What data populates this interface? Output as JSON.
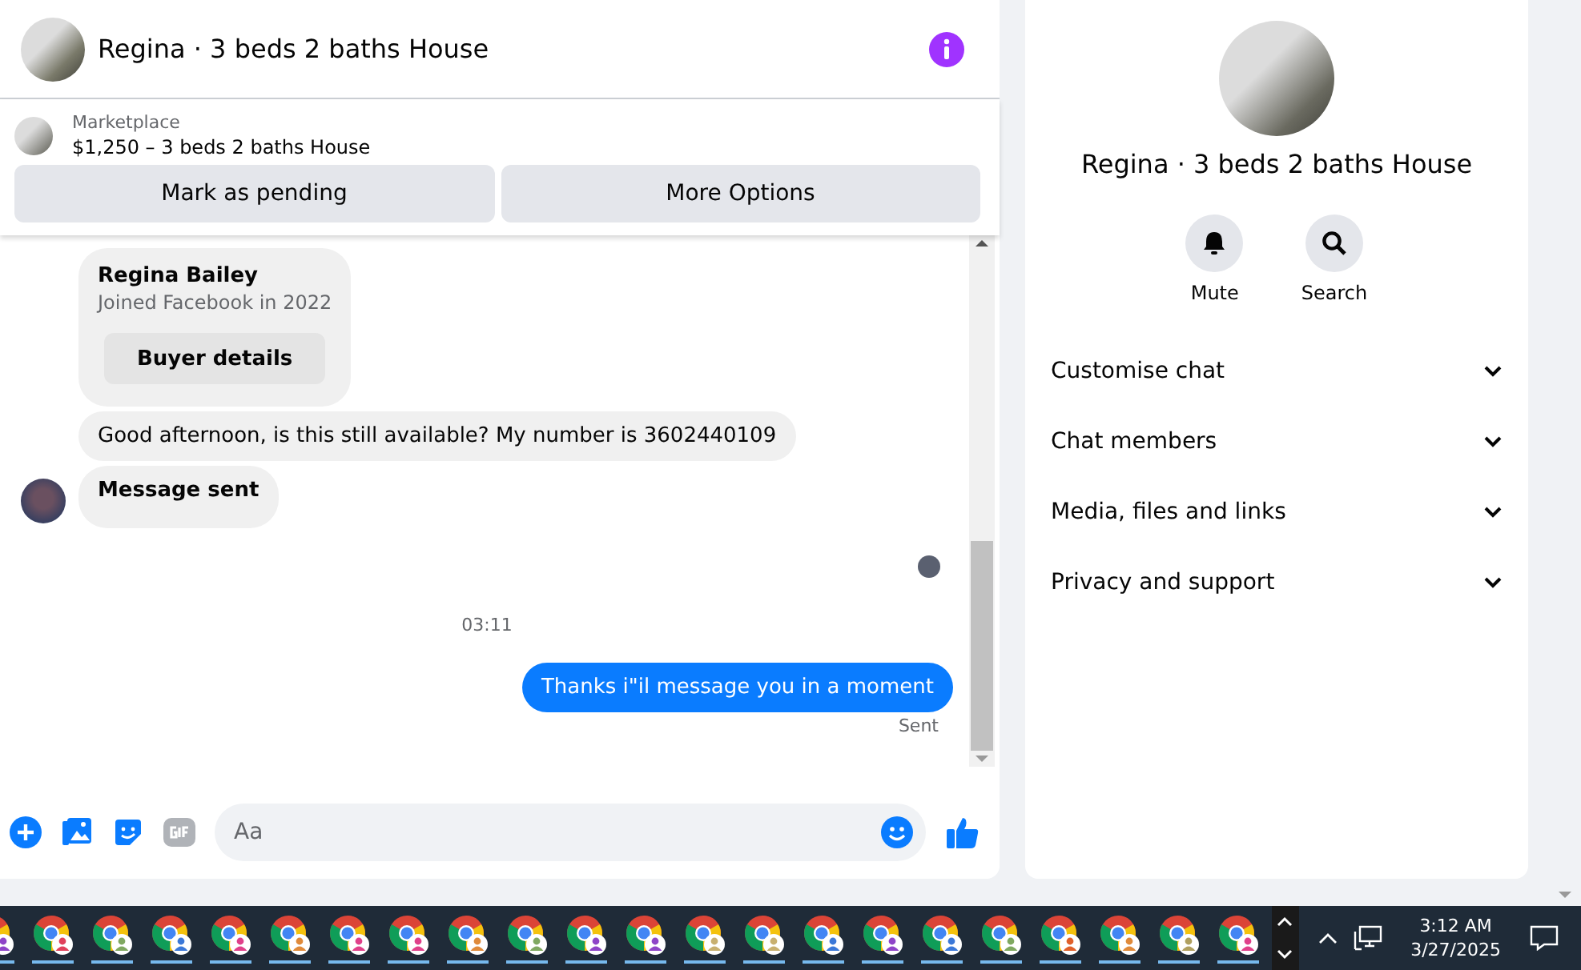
{
  "chat": {
    "title": "Regina · 3 beds 2 baths House",
    "listing": {
      "source": "Marketplace",
      "summary": "$1,250 – 3 beds 2 baths House"
    },
    "actions": [
      "Mark as pending",
      "More Options"
    ],
    "messages": [
      {
        "kind": "card",
        "name": "Regina Bailey",
        "subtitle": "Joined Facebook in 2022",
        "button": "Buyer details"
      },
      {
        "kind": "incoming",
        "text": "Good afternoon, is this still available? My number is 3602440109",
        "avatar": false,
        "bold": false
      },
      {
        "kind": "incoming",
        "text": "Message sent",
        "avatar": true,
        "bold": true
      },
      {
        "kind": "seen"
      },
      {
        "kind": "time",
        "text": "03:11"
      },
      {
        "kind": "outgoing",
        "text": "Thanks i\"il message you in a moment",
        "status": "Sent"
      }
    ],
    "composer": {
      "placeholder": "Aa"
    }
  },
  "details": {
    "title": "Regina · 3 beds 2 baths House",
    "buttons": [
      {
        "kind": "mute",
        "label": "Mute"
      },
      {
        "kind": "search",
        "label": "Search"
      }
    ],
    "sections": [
      {
        "label": "Customise chat",
        "expanded": false
      },
      {
        "label": "Chat members",
        "expanded": false
      },
      {
        "label": "Media, files and links",
        "expanded": false
      },
      {
        "label": "Privacy and support",
        "expanded": false
      }
    ]
  },
  "taskbar": {
    "apps": [
      {
        "color": "#8e44c8"
      },
      {
        "color": "#e0405a"
      },
      {
        "color": "#7fa860"
      },
      {
        "color": "#3b78d8"
      },
      {
        "color": "#e0408a"
      },
      {
        "color": "#e08a3a"
      },
      {
        "color": "#e0408a"
      },
      {
        "color": "#e0408a"
      },
      {
        "color": "#e08a3a"
      },
      {
        "color": "#7fa860"
      },
      {
        "color": "#8e44c8"
      },
      {
        "color": "#8e44c8"
      },
      {
        "color": "#c8b070"
      },
      {
        "color": "#c8b070"
      },
      {
        "color": "#3b78d8"
      },
      {
        "color": "#8e44c8"
      },
      {
        "color": "#3b78d8"
      },
      {
        "color": "#7fa860"
      },
      {
        "color": "#e0602a"
      },
      {
        "color": "#e08a3a"
      },
      {
        "color": "#b0a060"
      },
      {
        "color": "#e0408a"
      }
    ],
    "time": "3:12 AM",
    "date": "3/27/2025"
  }
}
